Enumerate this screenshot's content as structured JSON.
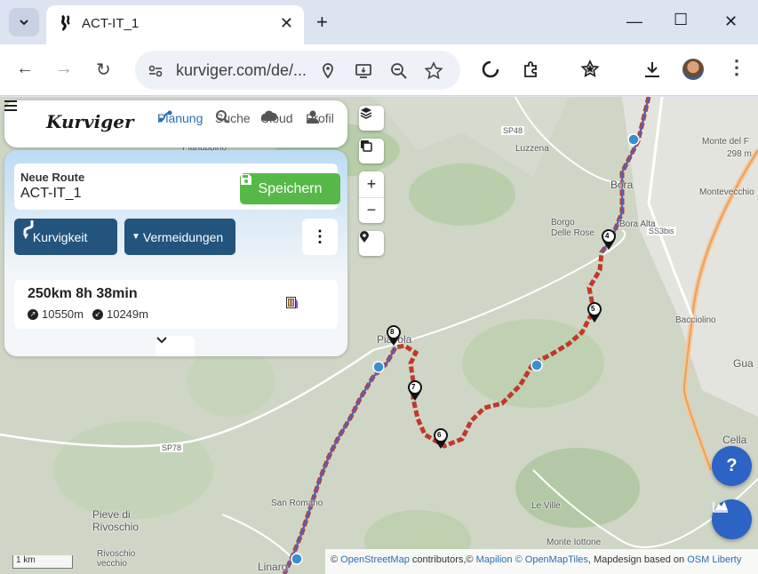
{
  "browser": {
    "tab_title": "ACT-IT_1",
    "url": "kurviger.com/de/...",
    "new_tab_icon": "plus-icon"
  },
  "app": {
    "brand": "Kurviger",
    "nav": [
      {
        "label": "Planung",
        "icon": "route-icon",
        "active": true
      },
      {
        "label": "Suche",
        "icon": "search-icon",
        "active": false
      },
      {
        "label": "Cloud",
        "icon": "cloud-icon",
        "active": false
      },
      {
        "label": "Profil",
        "icon": "person-icon",
        "active": false
      }
    ],
    "route": {
      "label": "Neue Route",
      "name": "ACT-IT_1",
      "save_label": "Speichern"
    },
    "buttons": {
      "curviness": "Kurvigkeit",
      "avoidances": "Vermeidungen"
    },
    "stats": {
      "summary": "250km  8h 38min",
      "ascent": "10550m",
      "descent": "10249m"
    }
  },
  "map": {
    "labels": {
      "planu": "Planubbino",
      "sp48": "SP48",
      "luzzena": "Luzzena",
      "monte_del": "Monte del F",
      "monte_alt": "298 m",
      "bora": "Bora",
      "montevecchio": "Montevecchio",
      "borgo": "Borgo",
      "delle_rose": "Delle Rose",
      "bora_alta": "Bora Alta",
      "ss3bis": "SS3bis",
      "bacciolino": "Bacciolino",
      "gua": "Gua",
      "piavola": "Piavola",
      "cella": "Cella",
      "sp78": "SP78",
      "pieve": "Pieve di",
      "rivoschio": "Rivoschio",
      "san_romano": "San Romano",
      "le_ville": "Le Ville",
      "monte_iottone": "Monte Iottone",
      "rivoschio_vecchio": "Rivoschio",
      "vecchio": "vecchio",
      "linaro": "Linaro"
    },
    "waypoints": [
      "4",
      "5",
      "6",
      "7",
      "8"
    ],
    "scale": "1 km",
    "attribution": {
      "prefix": "© ",
      "osm": "OpenStreetMap",
      "mid": " contributors,© ",
      "mapilion": "Mapilion",
      "sep": " ",
      "omt": "© OpenMapTiles",
      "design": ", Mapdesign based on ",
      "liberty": "OSM Liberty"
    },
    "route_color": "#c0392b",
    "route_alt_color": "#5b5fb0"
  },
  "fab": {
    "help": "?"
  }
}
